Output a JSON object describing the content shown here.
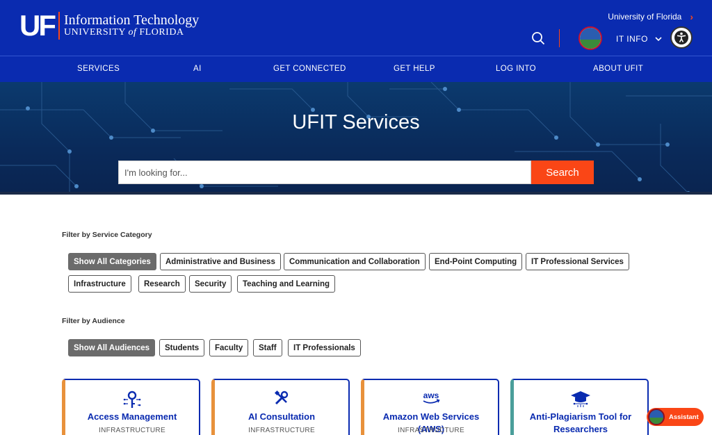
{
  "header": {
    "logo_mark": "UF",
    "logo_line1": "Information Technology",
    "logo_line2_pre": "UNIVERSITY",
    "logo_line2_of": "of",
    "logo_line2_post": "FLORIDA",
    "uf_link": "University of Florida",
    "it_info": "IT INFO"
  },
  "nav": {
    "items": [
      "SERVICES",
      "AI",
      "GET CONNECTED",
      "GET HELP",
      "LOG INTO",
      "ABOUT UFIT"
    ]
  },
  "hero": {
    "title": "UFIT Services",
    "search_placeholder": "I'm looking for...",
    "search_button": "Search"
  },
  "filters": {
    "category_label": "Filter by Service Category",
    "categories": [
      "Show All Categories",
      "Administrative and Business",
      "Communication and Collaboration",
      "End-Point Computing",
      "IT Professional Services",
      "Infrastructure",
      "Research",
      "Security",
      "Teaching and Learning"
    ],
    "audience_label": "Filter by Audience",
    "audiences": [
      "Show All Audiences",
      "Students",
      "Faculty",
      "Staff",
      "IT Professionals"
    ]
  },
  "cards": [
    {
      "title": "Access Management",
      "category": "INFRASTRUCTURE",
      "icon": "key-circuit-icon"
    },
    {
      "title": "AI Consultation",
      "category": "INFRASTRUCTURE",
      "icon": "tools-icon"
    },
    {
      "title": "Amazon Web Services (AWS)",
      "category": "INFRASTRUCTURE",
      "icon": "aws-logo-icon"
    },
    {
      "title": "Anti-Plagiarism Tool for Researchers",
      "category": "",
      "icon": "graduation-cap-icon"
    }
  ],
  "assistant": {
    "label": "Assistant"
  },
  "colors": {
    "brand_blue": "#0a2bb0",
    "accent_orange": "#fa4616",
    "chip_active": "#6b6b6b",
    "card_stripe_orange": "#e8913b",
    "card_stripe_teal": "#4a9e9a"
  }
}
